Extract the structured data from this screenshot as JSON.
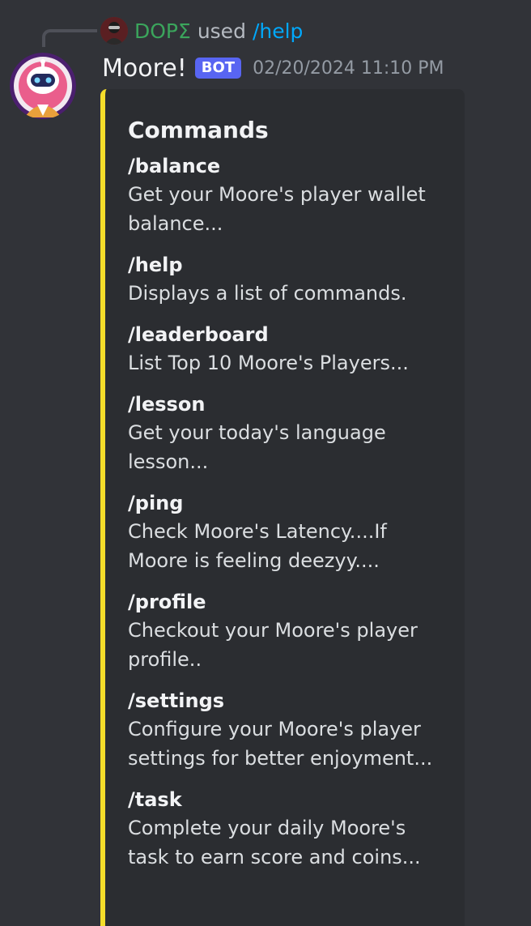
{
  "reply": {
    "username": "DOPΣ",
    "used_text": "used",
    "command": "/help",
    "avatar_icon": "user-avatar-icon",
    "username_color": "#3ba55c",
    "command_color": "#00a8fc"
  },
  "message": {
    "author": "Moore!",
    "bot_tag": "BOT",
    "timestamp": "02/20/2024 11:10 PM",
    "avatar_icon": "robot-avatar-icon",
    "bot_tag_color": "#5865f2"
  },
  "embed": {
    "accent_color": "#f5dd2a",
    "title": "Commands",
    "fields": [
      {
        "name": "/balance",
        "value": "Get your Moore's player wallet balance..."
      },
      {
        "name": "/help",
        "value": "Displays a list of commands."
      },
      {
        "name": "/leaderboard",
        "value": "List Top 10 Moore's Players..."
      },
      {
        "name": "/lesson",
        "value": "Get your today's language lesson..."
      },
      {
        "name": "/ping",
        "value": "Check Moore's Latency....If Moore is feeling deezyy...."
      },
      {
        "name": "/profile",
        "value": "Checkout your Moore's player profile.."
      },
      {
        "name": "/settings",
        "value": "Configure your Moore's player settings for better enjoyment..."
      },
      {
        "name": "/task",
        "value": "Complete your daily Moore's task to earn score and coins..."
      }
    ]
  }
}
